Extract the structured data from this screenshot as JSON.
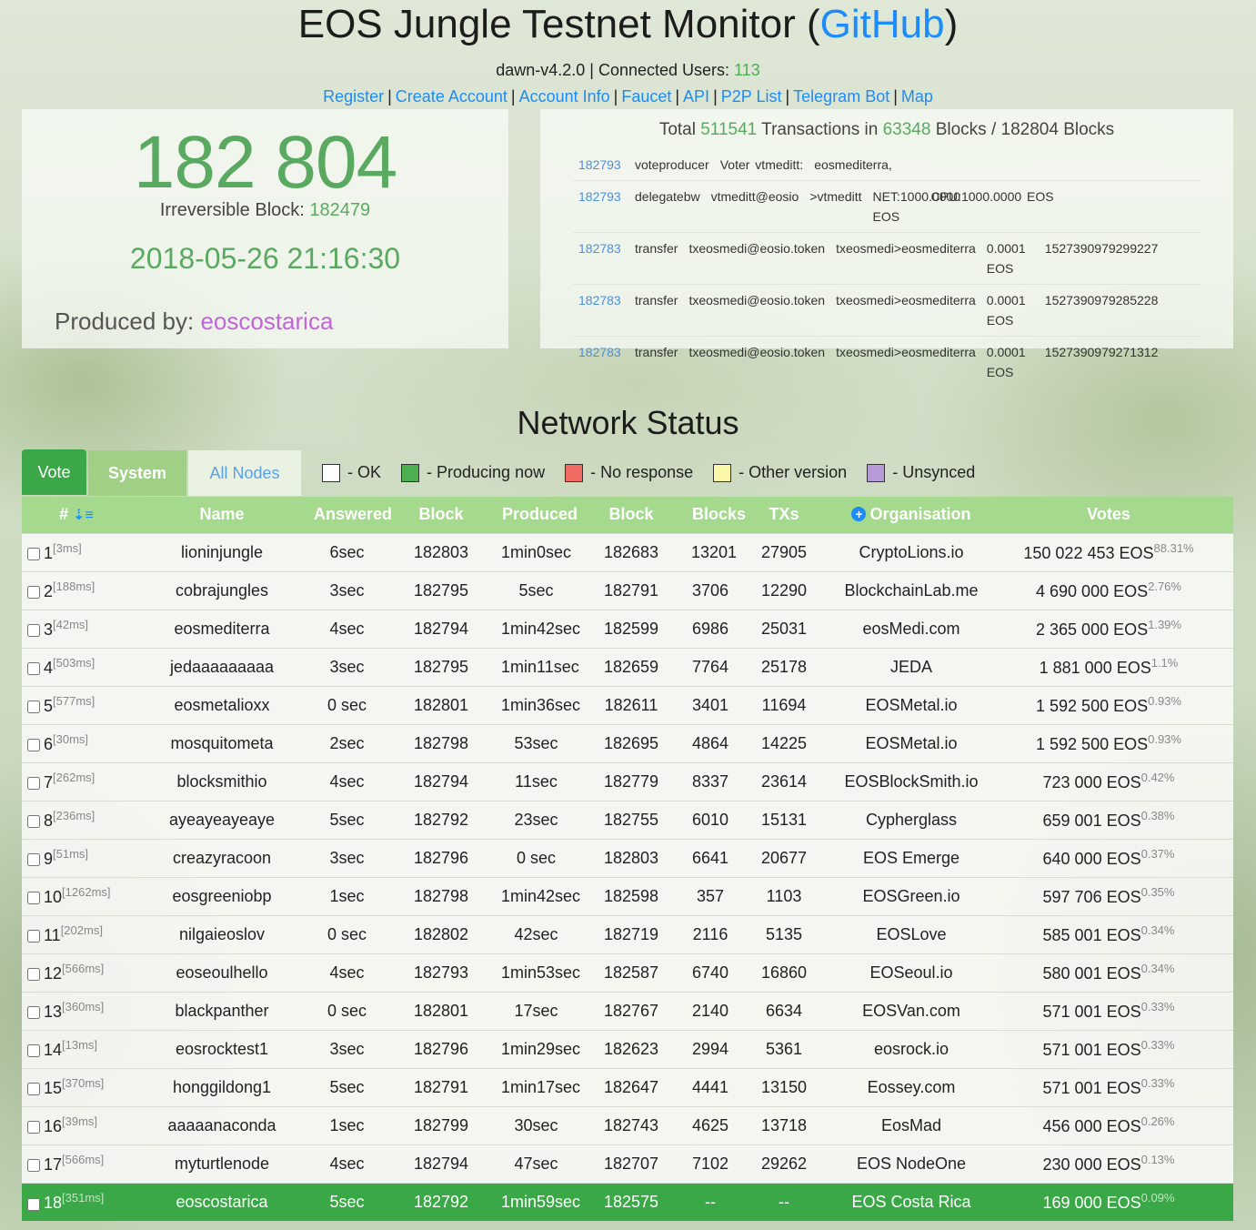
{
  "header": {
    "title_prefix": "EOS Jungle Testnet Monitor (",
    "title_link": "GitHub",
    "title_suffix": ")",
    "version": "dawn-v4.2.0",
    "connected_label": "Connected Users:",
    "connected_users": "113",
    "nav": [
      "Register",
      "Create Account",
      "Account Info",
      "Faucet",
      "API",
      "P2P List",
      "Telegram Bot",
      "Map"
    ]
  },
  "block_panel": {
    "head_block": "182 804",
    "irreversible_label": "Irreversible Block:",
    "irreversible_block": "182479",
    "datetime": "2018-05-26 21:16:30",
    "produced_label": "Produced by:",
    "producer": "eoscostarica"
  },
  "tx_panel": {
    "total_label": "Total",
    "total_tx": "511541",
    "tx_in_label": "Transactions in",
    "blocks": "63348",
    "blocks_label": "Blocks / 182804 Blocks",
    "rows": [
      {
        "block": "182793",
        "cols": [
          "voteproducer",
          "Voter vtmeditt:",
          "eosmediterra,"
        ]
      },
      {
        "block": "182793",
        "cols": [
          "delegatebw",
          "vtmeditt@eosio",
          ">vtmeditt",
          "NET:1000.0000 EOS",
          "CPU:1000.0000 EOS"
        ]
      },
      {
        "block": "182783",
        "cols": [
          "transfer",
          "txeosmedi@eosio.token",
          "txeosmedi>eosmediterra",
          "0.0001 EOS",
          "1527390979299227"
        ]
      },
      {
        "block": "182783",
        "cols": [
          "transfer",
          "txeosmedi@eosio.token",
          "txeosmedi>eosmediterra",
          "0.0001 EOS",
          "1527390979285228"
        ]
      },
      {
        "block": "182783",
        "cols": [
          "transfer",
          "txeosmedi@eosio.token",
          "txeosmedi>eosmediterra",
          "0.0001 EOS",
          "1527390979271312"
        ]
      }
    ]
  },
  "network": {
    "title": "Network Status",
    "tabs": [
      "Vote",
      "System",
      "All Nodes"
    ],
    "legend": [
      {
        "label": "- OK",
        "color": "#ffffff"
      },
      {
        "label": "- Producing now",
        "color": "#4caf50"
      },
      {
        "label": "- No response",
        "color": "#f26b63"
      },
      {
        "label": "- Other version",
        "color": "#fbf7a8"
      },
      {
        "label": "- Unsynced",
        "color": "#b79bd8"
      }
    ],
    "columns": [
      "#",
      "Name",
      "Answered",
      "Block",
      "Produced",
      "Block",
      "Blocks",
      "TXs",
      "Organisation",
      "Votes"
    ],
    "rows": [
      {
        "n": "1",
        "ping": "[3ms]",
        "name": "lioninjungle",
        "answered": "6sec",
        "block": "182803",
        "produced": "1min0sec",
        "pblock": "182683",
        "blocks": "13201",
        "txs": "27905",
        "org": "CryptoLions.io",
        "votes": "150 022 453 EOS",
        "pct": "88.31%"
      },
      {
        "n": "2",
        "ping": "[188ms]",
        "name": "cobrajungles",
        "answered": "3sec",
        "block": "182795",
        "produced": "5sec",
        "pblock": "182791",
        "blocks": "3706",
        "txs": "12290",
        "org": "BlockchainLab.me",
        "votes": "4 690 000 EOS",
        "pct": "2.76%"
      },
      {
        "n": "3",
        "ping": "[42ms]",
        "name": "eosmediterra",
        "answered": "4sec",
        "block": "182794",
        "produced": "1min42sec",
        "pblock": "182599",
        "blocks": "6986",
        "txs": "25031",
        "org": "eosMedi.com",
        "votes": "2 365 000 EOS",
        "pct": "1.39%"
      },
      {
        "n": "4",
        "ping": "[503ms]",
        "name": "jedaaaaaaaaa",
        "answered": "3sec",
        "block": "182795",
        "produced": "1min11sec",
        "pblock": "182659",
        "blocks": "7764",
        "txs": "25178",
        "org": "JEDA",
        "votes": "1 881 000 EOS",
        "pct": "1.1%"
      },
      {
        "n": "5",
        "ping": "[577ms]",
        "name": "eosmetalioxx",
        "answered": "0 sec",
        "block": "182801",
        "produced": "1min36sec",
        "pblock": "182611",
        "blocks": "3401",
        "txs": "11694",
        "org": "EOSMetal.io",
        "votes": "1 592 500 EOS",
        "pct": "0.93%"
      },
      {
        "n": "6",
        "ping": "[30ms]",
        "name": "mosquitometa",
        "answered": "2sec",
        "block": "182798",
        "produced": "53sec",
        "pblock": "182695",
        "blocks": "4864",
        "txs": "14225",
        "org": "EOSMetal.io",
        "votes": "1 592 500 EOS",
        "pct": "0.93%"
      },
      {
        "n": "7",
        "ping": "[262ms]",
        "name": "blocksmithio",
        "answered": "4sec",
        "block": "182794",
        "produced": "11sec",
        "pblock": "182779",
        "blocks": "8337",
        "txs": "23614",
        "org": "EOSBlockSmith.io",
        "votes": "723 000 EOS",
        "pct": "0.42%"
      },
      {
        "n": "8",
        "ping": "[236ms]",
        "name": "ayeayeayeaye",
        "answered": "5sec",
        "block": "182792",
        "produced": "23sec",
        "pblock": "182755",
        "blocks": "6010",
        "txs": "15131",
        "org": "Cypherglass",
        "votes": "659 001 EOS",
        "pct": "0.38%"
      },
      {
        "n": "9",
        "ping": "[51ms]",
        "name": "creazyracoon",
        "answered": "3sec",
        "block": "182796",
        "produced": "0 sec",
        "pblock": "182803",
        "blocks": "6641",
        "txs": "20677",
        "org": "EOS Emerge",
        "votes": "640 000 EOS",
        "pct": "0.37%"
      },
      {
        "n": "10",
        "ping": "[1262ms]",
        "name": "eosgreeniobp",
        "answered": "1sec",
        "block": "182798",
        "produced": "1min42sec",
        "pblock": "182598",
        "blocks": "357",
        "txs": "1103",
        "org": "EOSGreen.io",
        "votes": "597 706 EOS",
        "pct": "0.35%"
      },
      {
        "n": "11",
        "ping": "[202ms]",
        "name": "nilgaieoslov",
        "answered": "0 sec",
        "block": "182802",
        "produced": "42sec",
        "pblock": "182719",
        "blocks": "2116",
        "txs": "5135",
        "org": "EOSLove",
        "votes": "585 001 EOS",
        "pct": "0.34%"
      },
      {
        "n": "12",
        "ping": "[566ms]",
        "name": "eoseoulhello",
        "answered": "4sec",
        "block": "182793",
        "produced": "1min53sec",
        "pblock": "182587",
        "blocks": "6740",
        "txs": "16860",
        "org": "EOSeoul.io",
        "votes": "580 001 EOS",
        "pct": "0.34%"
      },
      {
        "n": "13",
        "ping": "[360ms]",
        "name": "blackpanther",
        "answered": "0 sec",
        "block": "182801",
        "produced": "17sec",
        "pblock": "182767",
        "blocks": "2140",
        "txs": "6634",
        "org": "EOSVan.com",
        "votes": "571 001 EOS",
        "pct": "0.33%"
      },
      {
        "n": "14",
        "ping": "[13ms]",
        "name": "eosrocktest1",
        "answered": "3sec",
        "block": "182796",
        "produced": "1min29sec",
        "pblock": "182623",
        "blocks": "2994",
        "txs": "5361",
        "org": "eosrock.io",
        "votes": "571 001 EOS",
        "pct": "0.33%"
      },
      {
        "n": "15",
        "ping": "[370ms]",
        "name": "honggildong1",
        "answered": "5sec",
        "block": "182791",
        "produced": "1min17sec",
        "pblock": "182647",
        "blocks": "4441",
        "txs": "13150",
        "org": "Eossey.com",
        "votes": "571 001 EOS",
        "pct": "0.33%"
      },
      {
        "n": "16",
        "ping": "[39ms]",
        "name": "aaaaanaconda",
        "answered": "1sec",
        "block": "182799",
        "produced": "30sec",
        "pblock": "182743",
        "blocks": "4625",
        "txs": "13718",
        "org": "EosMad",
        "votes": "456 000 EOS",
        "pct": "0.26%"
      },
      {
        "n": "17",
        "ping": "[566ms]",
        "name": "myturtlenode",
        "answered": "4sec",
        "block": "182794",
        "produced": "47sec",
        "pblock": "182707",
        "blocks": "7102",
        "txs": "29262",
        "org": "EOS NodeOne",
        "votes": "230 000 EOS",
        "pct": "0.13%"
      },
      {
        "n": "18",
        "ping": "[351ms]",
        "name": "eoscostarica",
        "answered": "5sec",
        "block": "182792",
        "produced": "1min59sec",
        "pblock": "182575",
        "blocks": "--",
        "txs": "--",
        "org": "EOS Costa Rica",
        "votes": "169 000 EOS",
        "pct": "0.09%",
        "producing": true
      }
    ]
  }
}
